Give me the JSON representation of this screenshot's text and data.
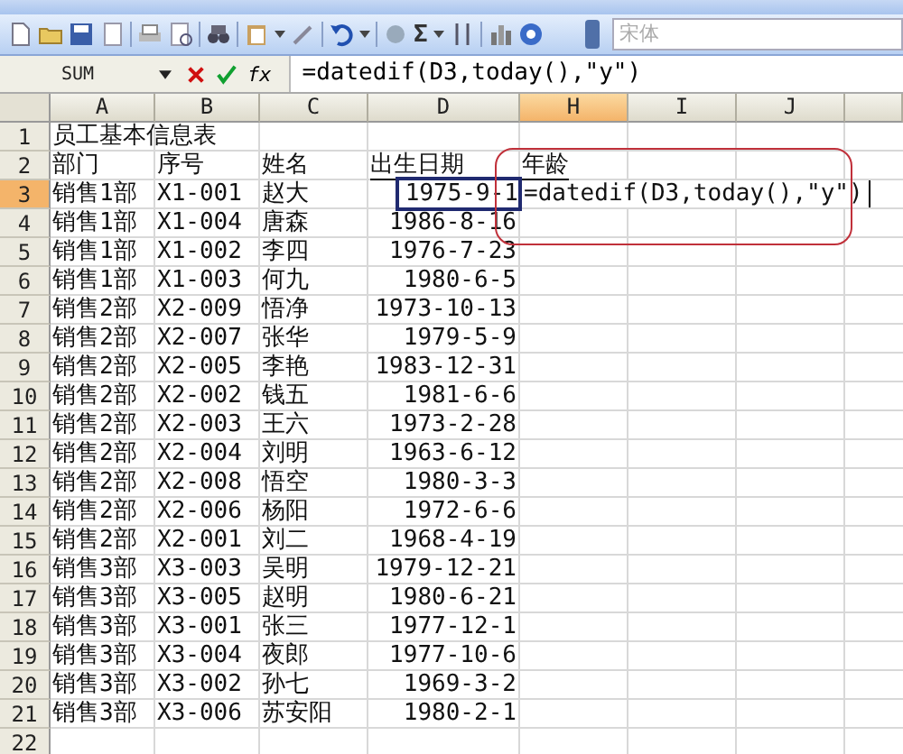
{
  "toolbar": {
    "sum_symbol": "Σ",
    "font_field": "宋体"
  },
  "formula_bar": {
    "name_box": "SUM",
    "fx": "fx",
    "formula": "=datedif(D3,today(),\"y\")"
  },
  "columns": [
    {
      "label": "A",
      "selected": false
    },
    {
      "label": "B",
      "selected": false
    },
    {
      "label": "C",
      "selected": false
    },
    {
      "label": "D",
      "selected": false
    },
    {
      "label": "H",
      "selected": true
    },
    {
      "label": "I",
      "selected": false
    },
    {
      "label": "J",
      "selected": false
    }
  ],
  "rows": [
    {
      "number": "1",
      "selected": false,
      "col_a": {
        "text": "员工基本信息表"
      }
    },
    {
      "number": "2",
      "selected": false,
      "col_a": {
        "text": "部门"
      },
      "col_b": {
        "text": "序号"
      },
      "col_c": {
        "text": "姓名"
      },
      "col_d": {
        "text": "出生日期",
        "kind": "header"
      },
      "col_h": {
        "text": "年龄",
        "kind": "header"
      }
    },
    {
      "number": "3",
      "selected": true,
      "col_a": {
        "text": "销售1部"
      },
      "col_b": {
        "text": "X1-001"
      },
      "col_c": {
        "text": "赵大"
      },
      "col_d": {
        "text": "1975-9-1",
        "kind": "date",
        "selected": true
      },
      "col_h": {
        "text": "=datedif(D3,today(),\"y\")",
        "kind": "editing"
      }
    },
    {
      "number": "4",
      "selected": false,
      "col_a": {
        "text": "销售1部"
      },
      "col_b": {
        "text": "X1-004"
      },
      "col_c": {
        "text": "唐森"
      },
      "col_d": {
        "text": "1986-8-16",
        "kind": "date"
      }
    },
    {
      "number": "5",
      "selected": false,
      "col_a": {
        "text": "销售1部"
      },
      "col_b": {
        "text": "X1-002"
      },
      "col_c": {
        "text": "李四"
      },
      "col_d": {
        "text": "1976-7-23",
        "kind": "date"
      }
    },
    {
      "number": "6",
      "selected": false,
      "col_a": {
        "text": "销售1部"
      },
      "col_b": {
        "text": "X1-003"
      },
      "col_c": {
        "text": "何九"
      },
      "col_d": {
        "text": "1980-6-5",
        "kind": "date"
      }
    },
    {
      "number": "7",
      "selected": false,
      "col_a": {
        "text": "销售2部"
      },
      "col_b": {
        "text": "X2-009"
      },
      "col_c": {
        "text": "悟净"
      },
      "col_d": {
        "text": "1973-10-13",
        "kind": "date"
      }
    },
    {
      "number": "8",
      "selected": false,
      "col_a": {
        "text": "销售2部"
      },
      "col_b": {
        "text": "X2-007"
      },
      "col_c": {
        "text": "张华"
      },
      "col_d": {
        "text": "1979-5-9",
        "kind": "date"
      }
    },
    {
      "number": "9",
      "selected": false,
      "col_a": {
        "text": "销售2部"
      },
      "col_b": {
        "text": "X2-005"
      },
      "col_c": {
        "text": "李艳"
      },
      "col_d": {
        "text": "1983-12-31",
        "kind": "date"
      }
    },
    {
      "number": "10",
      "selected": false,
      "col_a": {
        "text": "销售2部"
      },
      "col_b": {
        "text": "X2-002"
      },
      "col_c": {
        "text": "钱五"
      },
      "col_d": {
        "text": "1981-6-6",
        "kind": "date"
      }
    },
    {
      "number": "11",
      "selected": false,
      "col_a": {
        "text": "销售2部"
      },
      "col_b": {
        "text": "X2-003"
      },
      "col_c": {
        "text": "王六"
      },
      "col_d": {
        "text": "1973-2-28",
        "kind": "date"
      }
    },
    {
      "number": "12",
      "selected": false,
      "col_a": {
        "text": "销售2部"
      },
      "col_b": {
        "text": "X2-004"
      },
      "col_c": {
        "text": "刘明"
      },
      "col_d": {
        "text": "1963-6-12",
        "kind": "date"
      }
    },
    {
      "number": "13",
      "selected": false,
      "col_a": {
        "text": "销售2部"
      },
      "col_b": {
        "text": "X2-008"
      },
      "col_c": {
        "text": "悟空"
      },
      "col_d": {
        "text": "1980-3-3",
        "kind": "date"
      }
    },
    {
      "number": "14",
      "selected": false,
      "col_a": {
        "text": "销售2部"
      },
      "col_b": {
        "text": "X2-006"
      },
      "col_c": {
        "text": "杨阳"
      },
      "col_d": {
        "text": "1972-6-6",
        "kind": "date"
      }
    },
    {
      "number": "15",
      "selected": false,
      "col_a": {
        "text": "销售2部"
      },
      "col_b": {
        "text": "X2-001"
      },
      "col_c": {
        "text": "刘二"
      },
      "col_d": {
        "text": "1968-4-19",
        "kind": "date"
      }
    },
    {
      "number": "16",
      "selected": false,
      "col_a": {
        "text": "销售3部"
      },
      "col_b": {
        "text": "X3-003"
      },
      "col_c": {
        "text": "吴明"
      },
      "col_d": {
        "text": "1979-12-21",
        "kind": "date"
      }
    },
    {
      "number": "17",
      "selected": false,
      "col_a": {
        "text": "销售3部"
      },
      "col_b": {
        "text": "X3-005"
      },
      "col_c": {
        "text": "赵明"
      },
      "col_d": {
        "text": "1980-6-21",
        "kind": "date"
      }
    },
    {
      "number": "18",
      "selected": false,
      "col_a": {
        "text": "销售3部"
      },
      "col_b": {
        "text": "X3-001"
      },
      "col_c": {
        "text": "张三"
      },
      "col_d": {
        "text": "1977-12-1",
        "kind": "date"
      }
    },
    {
      "number": "19",
      "selected": false,
      "col_a": {
        "text": "销售3部"
      },
      "col_b": {
        "text": "X3-004"
      },
      "col_c": {
        "text": "夜郎"
      },
      "col_d": {
        "text": "1977-10-6",
        "kind": "date"
      }
    },
    {
      "number": "20",
      "selected": false,
      "col_a": {
        "text": "销售3部"
      },
      "col_b": {
        "text": "X3-002"
      },
      "col_c": {
        "text": "孙七"
      },
      "col_d": {
        "text": "1969-3-2",
        "kind": "date"
      }
    },
    {
      "number": "21",
      "selected": false,
      "col_a": {
        "text": "销售3部"
      },
      "col_b": {
        "text": "X3-006"
      },
      "col_c": {
        "text": "苏安阳"
      },
      "col_d": {
        "text": "1980-2-1",
        "kind": "date"
      }
    },
    {
      "number": "22",
      "selected": false
    }
  ]
}
